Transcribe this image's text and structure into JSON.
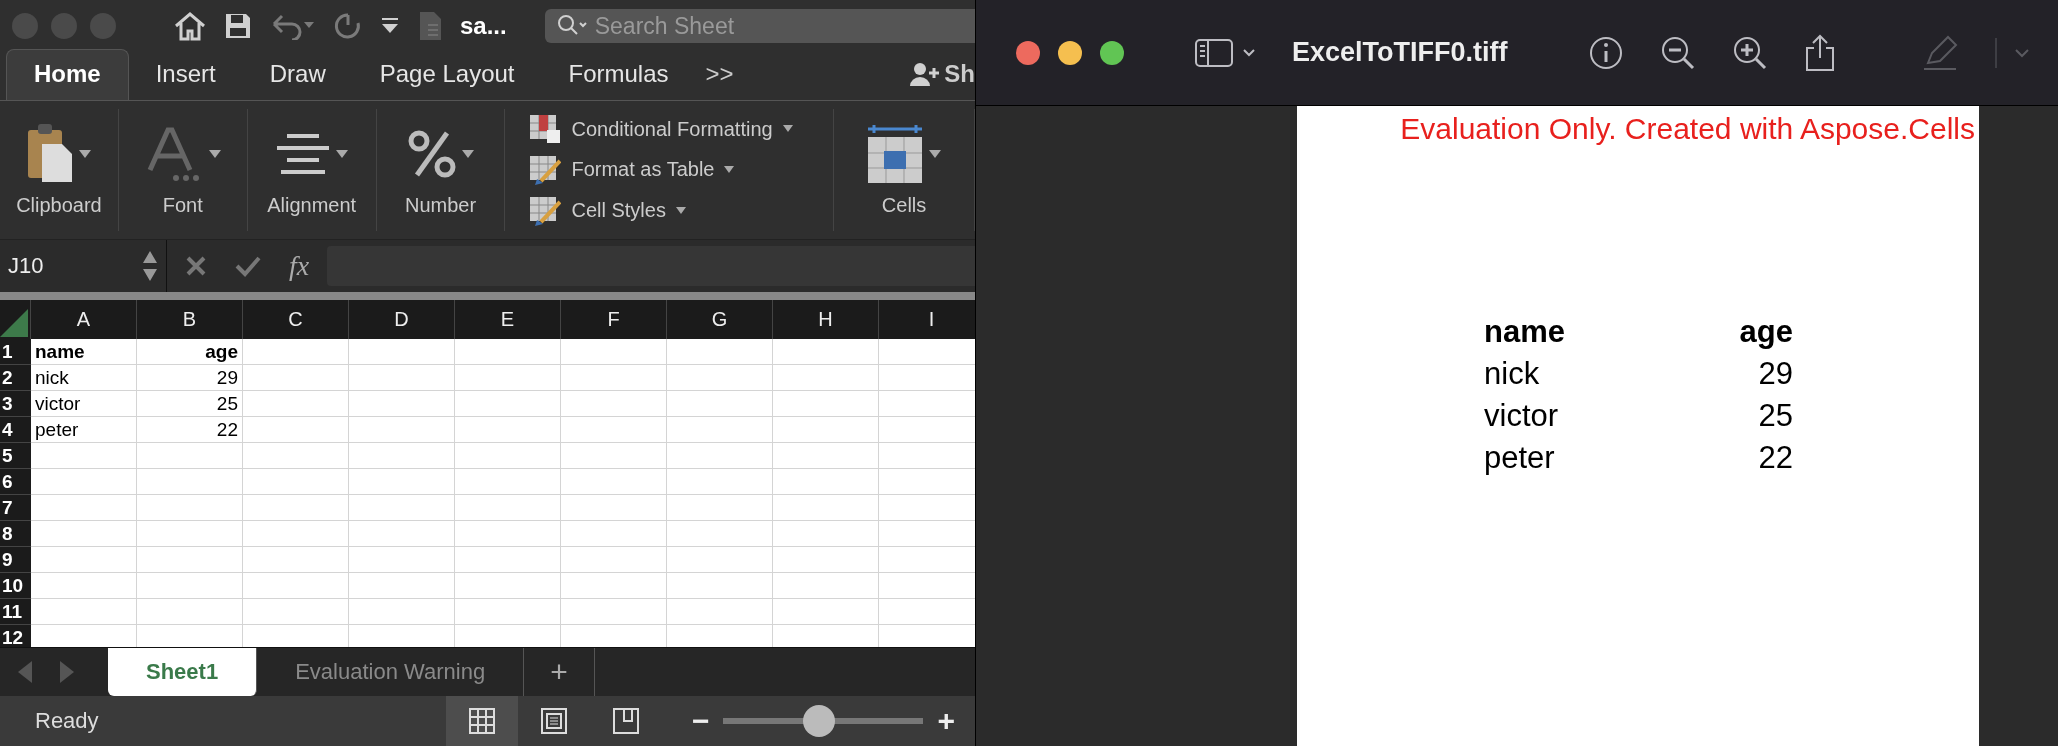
{
  "excel": {
    "title_bar": {
      "file_name": "sa...",
      "search_placeholder": "Search Sheet"
    },
    "tabs": [
      {
        "label": "Home",
        "selected": true
      },
      {
        "label": "Insert",
        "selected": false
      },
      {
        "label": "Draw",
        "selected": false
      },
      {
        "label": "Page Layout",
        "selected": false
      },
      {
        "label": "Formulas",
        "selected": false
      }
    ],
    "more_tabs": ">>",
    "share_label": "Sh",
    "ribbon_groups": [
      {
        "kind": "clipboard",
        "label": "Clipboard"
      },
      {
        "kind": "font",
        "label": "Font"
      },
      {
        "kind": "alignment",
        "label": "Alignment"
      },
      {
        "kind": "number",
        "label": "Number"
      },
      {
        "kind": "styles",
        "items": [
          "Conditional Formatting",
          "Format as Table",
          "Cell Styles"
        ]
      },
      {
        "kind": "cells",
        "label": "Cells"
      }
    ],
    "name_box": "J10",
    "formula_icon": "fx",
    "columns": [
      "A",
      "B",
      "C",
      "D",
      "E",
      "F",
      "G",
      "H",
      "I"
    ],
    "rows": [
      {
        "header": "1",
        "bold": true,
        "cells": [
          "name",
          "age"
        ]
      },
      {
        "header": "2",
        "bold": false,
        "cells": [
          "nick",
          "29"
        ]
      },
      {
        "header": "3",
        "bold": false,
        "cells": [
          "victor",
          "25"
        ]
      },
      {
        "header": "4",
        "bold": false,
        "cells": [
          "peter",
          "22"
        ]
      },
      {
        "header": "5",
        "cells": []
      },
      {
        "header": "6",
        "cells": []
      },
      {
        "header": "7",
        "cells": []
      },
      {
        "header": "8",
        "cells": []
      },
      {
        "header": "9",
        "cells": []
      },
      {
        "header": "10",
        "cells": []
      },
      {
        "header": "11",
        "cells": []
      },
      {
        "header": "12",
        "cells": []
      }
    ],
    "sheet_tabs": [
      {
        "label": "Sheet1",
        "selected": true
      },
      {
        "label": "Evaluation Warning",
        "selected": false
      }
    ],
    "add_sheet": "+",
    "status": "Ready",
    "view_buttons": [
      {
        "kind": "normal",
        "selected": true
      },
      {
        "kind": "page_layout",
        "selected": false
      },
      {
        "kind": "page_break",
        "selected": false
      }
    ],
    "zoom": {
      "minus": "−",
      "plus": "+",
      "level": 0.48
    }
  },
  "preview": {
    "title": "ExcelToTIFF0.tiff",
    "banner": "Evaluation Only. Created with Aspose.Cells",
    "table": {
      "header": [
        "name",
        "age"
      ],
      "rows": [
        [
          "nick",
          "29"
        ],
        [
          "victor",
          "25"
        ],
        [
          "peter",
          "22"
        ]
      ]
    }
  }
}
